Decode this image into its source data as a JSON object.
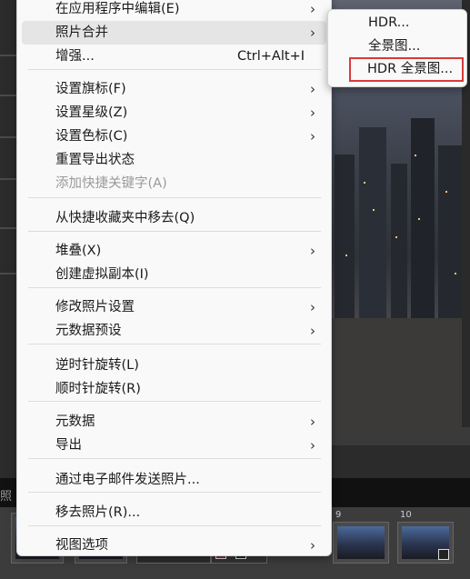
{
  "main_menu": {
    "items": [
      {
        "label": "在应用程序中编辑(E)",
        "shortcut": "",
        "submenu": true,
        "disabled": false
      },
      {
        "label": "照片合并",
        "shortcut": "",
        "submenu": true,
        "disabled": false,
        "highlighted": true
      },
      {
        "label": "增强...",
        "shortcut": "Ctrl+Alt+I",
        "submenu": false,
        "disabled": false
      },
      {
        "label": "设置旗标(F)",
        "shortcut": "",
        "submenu": true,
        "disabled": false
      },
      {
        "label": "设置星级(Z)",
        "shortcut": "",
        "submenu": true,
        "disabled": false
      },
      {
        "label": "设置色标(C)",
        "shortcut": "",
        "submenu": true,
        "disabled": false
      },
      {
        "label": "重置导出状态",
        "shortcut": "",
        "submenu": false,
        "disabled": false
      },
      {
        "label": "添加快捷关键字(A)",
        "shortcut": "",
        "submenu": false,
        "disabled": true
      },
      {
        "label": "从快捷收藏夹中移去(Q)",
        "shortcut": "",
        "submenu": false,
        "disabled": false
      },
      {
        "label": "堆叠(X)",
        "shortcut": "",
        "submenu": true,
        "disabled": false
      },
      {
        "label": "创建虚拟副本(I)",
        "shortcut": "",
        "submenu": false,
        "disabled": false
      },
      {
        "label": "修改照片设置",
        "shortcut": "",
        "submenu": true,
        "disabled": false
      },
      {
        "label": "元数据预设",
        "shortcut": "",
        "submenu": true,
        "disabled": false
      },
      {
        "label": "逆时针旋转(L)",
        "shortcut": "",
        "submenu": false,
        "disabled": false
      },
      {
        "label": "顺时针旋转(R)",
        "shortcut": "",
        "submenu": false,
        "disabled": false
      },
      {
        "label": "元数据",
        "shortcut": "",
        "submenu": true,
        "disabled": false
      },
      {
        "label": "导出",
        "shortcut": "",
        "submenu": true,
        "disabled": false
      },
      {
        "label": "通过电子邮件发送照片...",
        "shortcut": "",
        "submenu": false,
        "disabled": false
      },
      {
        "label": "移去照片(R)...",
        "shortcut": "",
        "submenu": false,
        "disabled": false
      },
      {
        "label": "视图选项",
        "shortcut": "",
        "submenu": true,
        "disabled": false
      }
    ],
    "arrow_glyph": "›"
  },
  "photo_merge_submenu": {
    "items": [
      {
        "label": "HDR..."
      },
      {
        "label": "全景图..."
      },
      {
        "label": "HDR 全景图...",
        "marked": true
      }
    ]
  },
  "filmstrip": {
    "label": "照",
    "numbers": [
      "9",
      "10"
    ]
  },
  "colors": {
    "menu_bg": "#f9f9f9",
    "highlight": "#e5e5e5",
    "annotation_box": "#d93a3a",
    "disabled_text": "#9a9a9a"
  }
}
